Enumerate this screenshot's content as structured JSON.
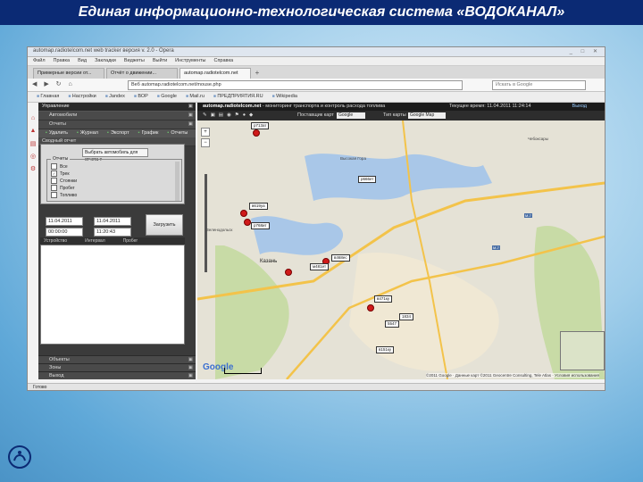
{
  "slide_title": "Единая информационно-технологическая система «ВОДОКАНАЛ»",
  "browser": {
    "window_title": "automap.radiotelcom.net web tracker версия v. 2.0 - Opera",
    "menu": [
      "Файл",
      "Правка",
      "Вид",
      "Закладки",
      "Виджеты",
      "Выйти",
      "Инструменты",
      "Справка"
    ],
    "tabs": [
      "Примерные версии от...",
      "Отчёт о движении...",
      "automap.radiotelcom.net"
    ],
    "address": "automap.radiotelcom.net/mouse.php",
    "address_prefix": "Веб",
    "search_placeholder": "Искать в Google",
    "bookmarks": [
      "Главная",
      "Настройки",
      "Jandex",
      "ВОР",
      "Google",
      "Mail.ru",
      "ПРЕДПРИЯТИЯ.RU",
      "Wikipedia"
    ],
    "status": "Готово"
  },
  "left_panel": {
    "header": "Управление",
    "section_autos": "Автомобили",
    "section_reports": "Отчеты",
    "tools": [
      "Удалить",
      "Журнал",
      "Экспорт",
      "График",
      "Отчеты"
    ],
    "summary_header": "Сводный отчет",
    "select_car": "Выбрать автомобиль для отчета",
    "fieldset_legend": "Отчеты",
    "checkboxes": [
      {
        "label": "Все",
        "checked": false
      },
      {
        "label": "Трек",
        "checked": true
      },
      {
        "label": "Стоянки",
        "checked": false
      },
      {
        "label": "Пробег",
        "checked": false
      },
      {
        "label": "Топливо",
        "checked": false
      }
    ],
    "date_from": "11.04.2011",
    "date_to": "11.04.2011",
    "time_from": "00:00:00",
    "time_to": "11:20:43",
    "load_button": "Загрузить",
    "grid_columns": [
      "Устройство",
      "Интервал",
      "Пробег"
    ],
    "bottom_sections": [
      "Объекты",
      "Зоны",
      "Выход"
    ]
  },
  "map": {
    "site": "automap.radiotelcom.net",
    "subtitle": " - мониторинг транспорта и контроль расхода топлива",
    "time": "Текущее время: 11.04.2011 11:24:14",
    "exit": "Выход",
    "tool_label_map": "Поставщик карт",
    "tool_map_value": "Google",
    "tool_label_type": "Тип карты",
    "tool_type_value": "Google Map",
    "vehicle_labels": [
      {
        "text": "р713ат",
        "name": "label-p713at"
      },
      {
        "text": "р666ет",
        "name": "label-p666et"
      },
      {
        "text": "в619уа",
        "name": "label-v619ua"
      },
      {
        "text": "р768ит",
        "name": "label-p768it"
      },
      {
        "text": "в468ес",
        "name": "label-v468es"
      },
      {
        "text": "м481ет",
        "name": "label-m481et"
      },
      {
        "text": "в471ку",
        "name": "label-v471ku"
      },
      {
        "text": "1834",
        "name": "label-1834"
      },
      {
        "text": "5547",
        "name": "label-5547"
      },
      {
        "text": "в151ку",
        "name": "label-v151ku"
      }
    ],
    "city_labels": [
      "Казань",
      "Зеленодольск",
      "Высокая Гора",
      "Чебоксары"
    ],
    "copyright": "©2011 Google · Данные карт ©2011 Geocentre Consulting, Tele Atlas · Условия использования",
    "google": "Google"
  },
  "colors": {
    "title_bar": "#0b2a74",
    "marker": "#d01a1a",
    "panel": "#3b3b3b"
  }
}
